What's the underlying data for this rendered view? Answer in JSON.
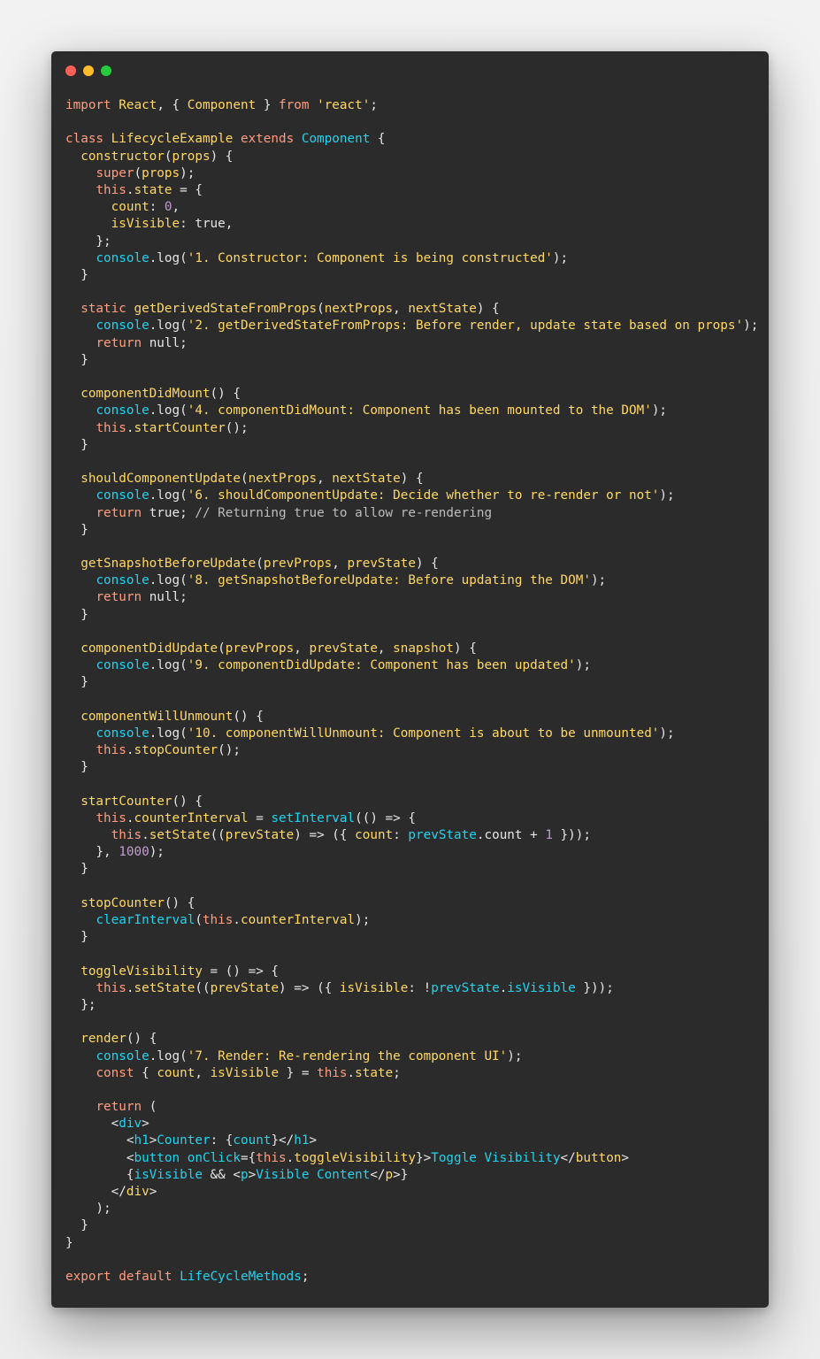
{
  "window": {
    "controls": [
      "close",
      "minimize",
      "maximize"
    ],
    "colors": {
      "background": "#2b2b2b",
      "close": "#ff5f56",
      "minimize": "#ffbd2e",
      "maximize": "#27c93f"
    }
  },
  "code": {
    "language": "javascript",
    "lines": [
      [
        [
          "kw",
          "import "
        ],
        [
          "fn",
          "React"
        ],
        [
          "plain",
          ", { "
        ],
        [
          "fn",
          "Component"
        ],
        [
          "plain",
          " } "
        ],
        [
          "kw",
          "from "
        ],
        [
          "str",
          "'react'"
        ],
        [
          "plain",
          ";"
        ]
      ],
      [],
      [
        [
          "kw",
          "class "
        ],
        [
          "fn",
          "LifecycleExample "
        ],
        [
          "kw",
          "extends "
        ],
        [
          "type",
          "Component"
        ],
        [
          "plain",
          " {"
        ]
      ],
      [
        [
          "plain",
          "  "
        ],
        [
          "fn",
          "constructor"
        ],
        [
          "plain",
          "("
        ],
        [
          "param",
          "props"
        ],
        [
          "plain",
          ") {"
        ]
      ],
      [
        [
          "plain",
          "    "
        ],
        [
          "kw",
          "super"
        ],
        [
          "plain",
          "("
        ],
        [
          "param",
          "props"
        ],
        [
          "plain",
          ");"
        ]
      ],
      [
        [
          "plain",
          "    "
        ],
        [
          "kw",
          "this"
        ],
        [
          "plain",
          "."
        ],
        [
          "param",
          "state"
        ],
        [
          "plain",
          " = {"
        ]
      ],
      [
        [
          "plain",
          "      "
        ],
        [
          "param",
          "count"
        ],
        [
          "plain",
          ": "
        ],
        [
          "num",
          "0"
        ],
        [
          "plain",
          ","
        ]
      ],
      [
        [
          "plain",
          "      "
        ],
        [
          "param",
          "isVisible"
        ],
        [
          "plain",
          ": true,"
        ]
      ],
      [
        [
          "plain",
          "    };"
        ]
      ],
      [
        [
          "plain",
          "    "
        ],
        [
          "type",
          "console"
        ],
        [
          "plain",
          ".log("
        ],
        [
          "str",
          "'1. Constructor: Component is being constructed'"
        ],
        [
          "plain",
          ");"
        ]
      ],
      [
        [
          "plain",
          "  }"
        ]
      ],
      [],
      [
        [
          "plain",
          "  "
        ],
        [
          "kw",
          "static "
        ],
        [
          "fn",
          "getDerivedStateFromProps"
        ],
        [
          "plain",
          "("
        ],
        [
          "param",
          "nextProps"
        ],
        [
          "plain",
          ", "
        ],
        [
          "param",
          "nextState"
        ],
        [
          "plain",
          ") {"
        ]
      ],
      [
        [
          "plain",
          "    "
        ],
        [
          "type",
          "console"
        ],
        [
          "plain",
          ".log("
        ],
        [
          "str",
          "'2. getDerivedStateFromProps: Before render, update state based on props'"
        ],
        [
          "plain",
          ");"
        ]
      ],
      [
        [
          "plain",
          "    "
        ],
        [
          "kw",
          "return "
        ],
        [
          "plain",
          "null;"
        ]
      ],
      [
        [
          "plain",
          "  }"
        ]
      ],
      [],
      [
        [
          "plain",
          "  "
        ],
        [
          "fn",
          "componentDidMount"
        ],
        [
          "plain",
          "() {"
        ]
      ],
      [
        [
          "plain",
          "    "
        ],
        [
          "type",
          "console"
        ],
        [
          "plain",
          ".log("
        ],
        [
          "str",
          "'4. componentDidMount: Component has been mounted to the DOM'"
        ],
        [
          "plain",
          ");"
        ]
      ],
      [
        [
          "plain",
          "    "
        ],
        [
          "kw",
          "this"
        ],
        [
          "plain",
          "."
        ],
        [
          "fn",
          "startCounter"
        ],
        [
          "plain",
          "();"
        ]
      ],
      [
        [
          "plain",
          "  }"
        ]
      ],
      [],
      [
        [
          "plain",
          "  "
        ],
        [
          "fn",
          "shouldComponentUpdate"
        ],
        [
          "plain",
          "("
        ],
        [
          "param",
          "nextProps"
        ],
        [
          "plain",
          ", "
        ],
        [
          "param",
          "nextState"
        ],
        [
          "plain",
          ") {"
        ]
      ],
      [
        [
          "plain",
          "    "
        ],
        [
          "type",
          "console"
        ],
        [
          "plain",
          ".log("
        ],
        [
          "str",
          "'6. shouldComponentUpdate: Decide whether to re-render or not'"
        ],
        [
          "plain",
          ");"
        ]
      ],
      [
        [
          "plain",
          "    "
        ],
        [
          "kw",
          "return "
        ],
        [
          "plain",
          "true; "
        ],
        [
          "comment",
          "// Returning true to allow re-rendering"
        ]
      ],
      [
        [
          "plain",
          "  }"
        ]
      ],
      [],
      [
        [
          "plain",
          "  "
        ],
        [
          "fn",
          "getSnapshotBeforeUpdate"
        ],
        [
          "plain",
          "("
        ],
        [
          "param",
          "prevProps"
        ],
        [
          "plain",
          ", "
        ],
        [
          "param",
          "prevState"
        ],
        [
          "plain",
          ") {"
        ]
      ],
      [
        [
          "plain",
          "    "
        ],
        [
          "type",
          "console"
        ],
        [
          "plain",
          ".log("
        ],
        [
          "str",
          "'8. getSnapshotBeforeUpdate: Before updating the DOM'"
        ],
        [
          "plain",
          ");"
        ]
      ],
      [
        [
          "plain",
          "    "
        ],
        [
          "kw",
          "return "
        ],
        [
          "plain",
          "null;"
        ]
      ],
      [
        [
          "plain",
          "  }"
        ]
      ],
      [],
      [
        [
          "plain",
          "  "
        ],
        [
          "fn",
          "componentDidUpdate"
        ],
        [
          "plain",
          "("
        ],
        [
          "param",
          "prevProps"
        ],
        [
          "plain",
          ", "
        ],
        [
          "param",
          "prevState"
        ],
        [
          "plain",
          ", "
        ],
        [
          "param",
          "snapshot"
        ],
        [
          "plain",
          ") {"
        ]
      ],
      [
        [
          "plain",
          "    "
        ],
        [
          "type",
          "console"
        ],
        [
          "plain",
          ".log("
        ],
        [
          "str",
          "'9. componentDidUpdate: Component has been updated'"
        ],
        [
          "plain",
          ");"
        ]
      ],
      [
        [
          "plain",
          "  }"
        ]
      ],
      [],
      [
        [
          "plain",
          "  "
        ],
        [
          "fn",
          "componentWillUnmount"
        ],
        [
          "plain",
          "() {"
        ]
      ],
      [
        [
          "plain",
          "    "
        ],
        [
          "type",
          "console"
        ],
        [
          "plain",
          ".log("
        ],
        [
          "str",
          "'10. componentWillUnmount: Component is about to be unmounted'"
        ],
        [
          "plain",
          ");"
        ]
      ],
      [
        [
          "plain",
          "    "
        ],
        [
          "kw",
          "this"
        ],
        [
          "plain",
          "."
        ],
        [
          "fn",
          "stopCounter"
        ],
        [
          "plain",
          "();"
        ]
      ],
      [
        [
          "plain",
          "  }"
        ]
      ],
      [],
      [
        [
          "plain",
          "  "
        ],
        [
          "fn",
          "startCounter"
        ],
        [
          "plain",
          "() {"
        ]
      ],
      [
        [
          "plain",
          "    "
        ],
        [
          "kw",
          "this"
        ],
        [
          "plain",
          "."
        ],
        [
          "param",
          "counterInterval"
        ],
        [
          "plain",
          " = "
        ],
        [
          "type",
          "setInterval"
        ],
        [
          "plain",
          "(() => {"
        ]
      ],
      [
        [
          "plain",
          "      "
        ],
        [
          "kw",
          "this"
        ],
        [
          "plain",
          "."
        ],
        [
          "fn",
          "setState"
        ],
        [
          "plain",
          "(("
        ],
        [
          "param",
          "prevState"
        ],
        [
          "plain",
          ") => ({ "
        ],
        [
          "param",
          "count"
        ],
        [
          "plain",
          ": "
        ],
        [
          "type",
          "prevState"
        ],
        [
          "plain",
          ".count + "
        ],
        [
          "num",
          "1"
        ],
        [
          "plain",
          " }));"
        ]
      ],
      [
        [
          "plain",
          "    }, "
        ],
        [
          "num",
          "1000"
        ],
        [
          "plain",
          ");"
        ]
      ],
      [
        [
          "plain",
          "  }"
        ]
      ],
      [],
      [
        [
          "plain",
          "  "
        ],
        [
          "fn",
          "stopCounter"
        ],
        [
          "plain",
          "() {"
        ]
      ],
      [
        [
          "plain",
          "    "
        ],
        [
          "type",
          "clearInterval"
        ],
        [
          "plain",
          "("
        ],
        [
          "kw",
          "this"
        ],
        [
          "plain",
          "."
        ],
        [
          "param",
          "counterInterval"
        ],
        [
          "plain",
          ");"
        ]
      ],
      [
        [
          "plain",
          "  }"
        ]
      ],
      [],
      [
        [
          "plain",
          "  "
        ],
        [
          "fn",
          "toggleVisibility"
        ],
        [
          "plain",
          " = () => {"
        ]
      ],
      [
        [
          "plain",
          "    "
        ],
        [
          "kw",
          "this"
        ],
        [
          "plain",
          "."
        ],
        [
          "fn",
          "setState"
        ],
        [
          "plain",
          "(("
        ],
        [
          "param",
          "prevState"
        ],
        [
          "plain",
          ") => ({ "
        ],
        [
          "param",
          "isVisible"
        ],
        [
          "plain",
          ": !"
        ],
        [
          "type",
          "prevState"
        ],
        [
          "plain",
          "."
        ],
        [
          "type",
          "isVisible"
        ],
        [
          "plain",
          " }));"
        ]
      ],
      [
        [
          "plain",
          "  };"
        ]
      ],
      [],
      [
        [
          "plain",
          "  "
        ],
        [
          "fn",
          "render"
        ],
        [
          "plain",
          "() {"
        ]
      ],
      [
        [
          "plain",
          "    "
        ],
        [
          "type",
          "console"
        ],
        [
          "plain",
          ".log("
        ],
        [
          "str",
          "'7. Render: Re-rendering the component UI'"
        ],
        [
          "plain",
          ");"
        ]
      ],
      [
        [
          "plain",
          "    "
        ],
        [
          "kw",
          "const "
        ],
        [
          "plain",
          "{ "
        ],
        [
          "param",
          "count"
        ],
        [
          "plain",
          ", "
        ],
        [
          "param",
          "isVisible"
        ],
        [
          "plain",
          " } = "
        ],
        [
          "kw",
          "this"
        ],
        [
          "plain",
          "."
        ],
        [
          "param",
          "state"
        ],
        [
          "plain",
          ";"
        ]
      ],
      [],
      [
        [
          "plain",
          "    "
        ],
        [
          "kw",
          "return "
        ],
        [
          "plain",
          "("
        ]
      ],
      [
        [
          "plain",
          "      <"
        ],
        [
          "tag",
          "div"
        ],
        [
          "plain",
          ">"
        ]
      ],
      [
        [
          "plain",
          "        <"
        ],
        [
          "tag",
          "h1"
        ],
        [
          "plain",
          ">"
        ],
        [
          "tag",
          "Counter"
        ],
        [
          "plain",
          ": {"
        ],
        [
          "tag",
          "count"
        ],
        [
          "plain",
          "}</"
        ],
        [
          "tag",
          "h1"
        ],
        [
          "plain",
          ">"
        ]
      ],
      [
        [
          "plain",
          "        <"
        ],
        [
          "tag",
          "button"
        ],
        [
          "plain",
          " "
        ],
        [
          "tag",
          "onClick"
        ],
        [
          "plain",
          "={"
        ],
        [
          "kw",
          "this"
        ],
        [
          "plain",
          "."
        ],
        [
          "fn",
          "toggleVisibility"
        ],
        [
          "plain",
          "}>"
        ],
        [
          "tag",
          "Toggle Visibility"
        ],
        [
          "plain",
          "</"
        ],
        [
          "fn",
          "button"
        ],
        [
          "plain",
          ">"
        ]
      ],
      [
        [
          "plain",
          "        {"
        ],
        [
          "tag",
          "isVisible"
        ],
        [
          "plain",
          " && <"
        ],
        [
          "tag",
          "p"
        ],
        [
          "plain",
          ">"
        ],
        [
          "tag",
          "Visible Content"
        ],
        [
          "plain",
          "</"
        ],
        [
          "fn",
          "p"
        ],
        [
          "plain",
          ">}"
        ]
      ],
      [
        [
          "plain",
          "      </"
        ],
        [
          "fn",
          "div"
        ],
        [
          "plain",
          ">"
        ]
      ],
      [
        [
          "plain",
          "    );"
        ]
      ],
      [
        [
          "plain",
          "  }"
        ]
      ],
      [
        [
          "plain",
          "}"
        ]
      ],
      [],
      [
        [
          "kw",
          "export "
        ],
        [
          "kw",
          "default "
        ],
        [
          "type",
          "LifeCycleMethods"
        ],
        [
          "plain",
          ";"
        ]
      ]
    ]
  }
}
